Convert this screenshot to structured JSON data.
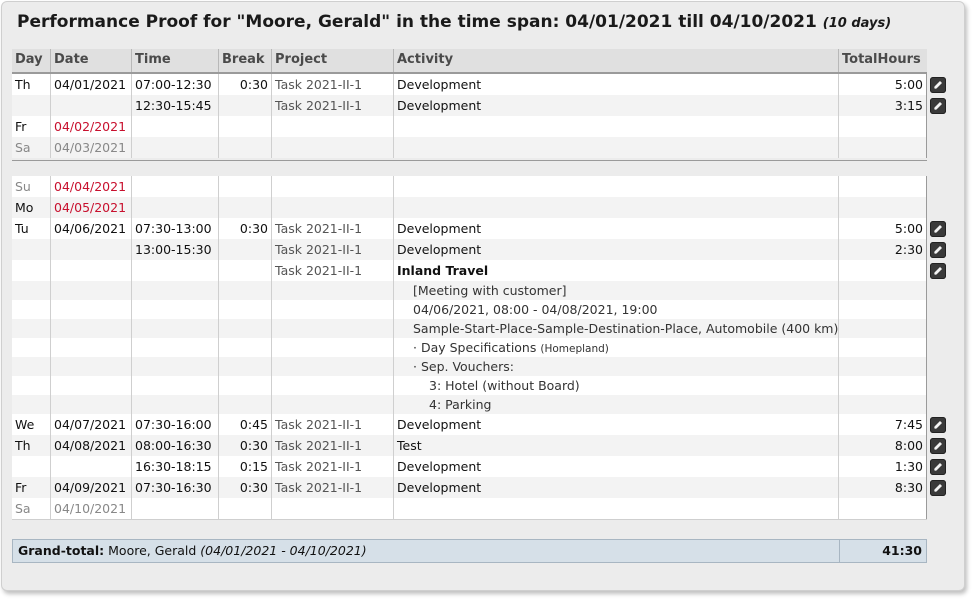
{
  "title": {
    "main": "Performance Proof for \"Moore, Gerald\" in the time span: 04/01/2021 till 04/10/2021",
    "span": "(10 days)"
  },
  "columns": [
    "Day",
    "Date",
    "Time",
    "Break",
    "Project",
    "Activity",
    "TotalHours"
  ],
  "block1": [
    {
      "day": "Th",
      "date": "04/01/2021",
      "time": "07:00-12:30",
      "brk": "0:30",
      "project": "Task 2021-II-1",
      "activity": "Development",
      "hours": "5:00",
      "edit": true
    },
    {
      "day": "",
      "date": "",
      "time": "12:30-15:45",
      "brk": "",
      "project": "Task 2021-II-1",
      "activity": "Development",
      "hours": "3:15",
      "edit": true
    },
    {
      "day": "Fr",
      "date": "04/02/2021",
      "time": "",
      "brk": "",
      "project": "",
      "activity": "",
      "hours": "",
      "edit": false
    },
    {
      "day": "Sa",
      "date": "04/03/2021",
      "time": "",
      "brk": "",
      "project": "",
      "activity": "",
      "hours": "",
      "edit": false
    }
  ],
  "block2": [
    {
      "day": "Su",
      "date": "04/04/2021",
      "time": "",
      "brk": "",
      "project": "",
      "activity": "",
      "hours": "",
      "edit": false
    },
    {
      "day": "Mo",
      "date": "04/05/2021",
      "time": "",
      "brk": "",
      "project": "",
      "activity": "",
      "hours": "",
      "edit": false
    },
    {
      "day": "Tu",
      "date": "04/06/2021",
      "time": "07:30-13:00",
      "brk": "0:30",
      "project": "Task 2021-II-1",
      "activity": "Development",
      "hours": "5:00",
      "edit": true
    },
    {
      "day": "",
      "date": "",
      "time": "13:00-15:30",
      "brk": "",
      "project": "Task 2021-II-1",
      "activity": "Development",
      "hours": "2:30",
      "edit": true
    },
    {
      "day": "",
      "date": "",
      "time": "",
      "brk": "",
      "project": "Task 2021-II-1",
      "activity": "Inland Travel",
      "hours": "",
      "edit": true
    },
    {
      "detail": "[Meeting with customer]"
    },
    {
      "detail": "04/06/2021, 08:00 - 04/08/2021, 19:00"
    },
    {
      "detail": "Sample-Start-Place-Sample-Destination-Place, Automobile  (400 km)"
    },
    {
      "detail": "· Day Specifications",
      "detail_small": "(Homepland)"
    },
    {
      "detail": "· Sep. Vouchers:"
    },
    {
      "detail": "3:  Hotel (without Board)",
      "indent": true
    },
    {
      "detail": "4:  Parking",
      "indent": true
    },
    {
      "day": "We",
      "date": "04/07/2021",
      "time": "07:30-16:00",
      "brk": "0:45",
      "project": "Task 2021-II-1",
      "activity": "Development",
      "hours": "7:45",
      "edit": true
    },
    {
      "day": "Th",
      "date": "04/08/2021",
      "time": "08:00-16:30",
      "brk": "0:30",
      "project": "Task 2021-II-1",
      "activity": "Test",
      "hours": "8:00",
      "edit": true
    },
    {
      "day": "",
      "date": "",
      "time": "16:30-18:15",
      "brk": "0:15",
      "project": "Task 2021-II-1",
      "activity": "Development",
      "hours": "1:30",
      "edit": true
    },
    {
      "day": "Fr",
      "date": "04/09/2021",
      "time": "07:30-16:30",
      "brk": "0:30",
      "project": "Task 2021-II-1",
      "activity": "Development",
      "hours": "8:30",
      "edit": true
    },
    {
      "day": "Sa",
      "date": "04/10/2021",
      "time": "",
      "brk": "",
      "project": "",
      "activity": "",
      "hours": "",
      "edit": false
    }
  ],
  "grand": {
    "label": "Grand-total:",
    "name": "Moore, Gerald",
    "range": "(04/01/2021 - 04/10/2021)",
    "total": "41:30"
  },
  "colors": {
    "weekend_gray": "#888888",
    "holiday_red": "#c8102e",
    "total_bg": "#d6e0e8"
  },
  "icons": {
    "edit": "edit-pencil-icon"
  }
}
